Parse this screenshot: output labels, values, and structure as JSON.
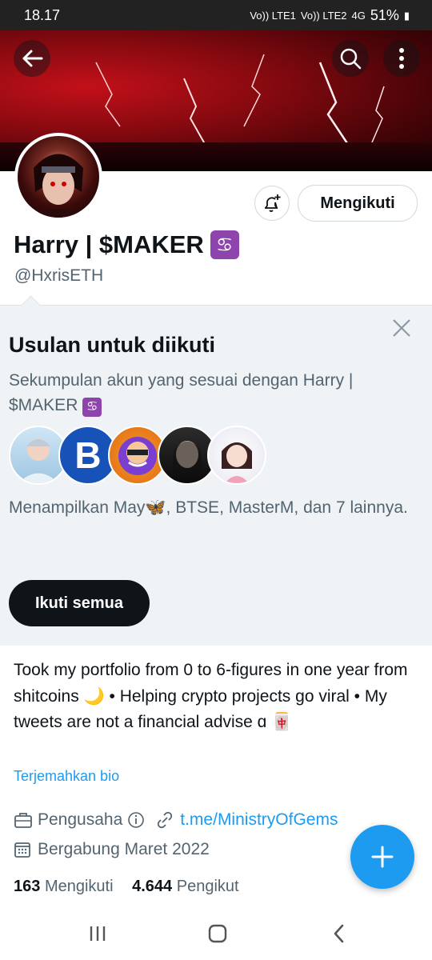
{
  "status_bar": {
    "time": "18.17",
    "sim1": "Vo)) LTE1",
    "sim2": "Vo)) LTE2",
    "network": "4G",
    "battery": "51%"
  },
  "profile": {
    "name": "Harry | $MAKER",
    "zodiac": "♋",
    "handle": "@HxrisETH",
    "follow_label": "Mengikuti"
  },
  "suggestions": {
    "title": "Usulan untuk diikuti",
    "description": "Sekumpulan akun yang sesuai dengan Harry | $MAKER",
    "shown_text": "Menampilkan May🦋, BTSE, MasterM, dan 7 lainnya.",
    "follow_all_label": "Ikuti semua",
    "avatars": [
      "may-avatar",
      "btse-avatar",
      "masterm-avatar",
      "izzy-avatar",
      "yalli-avatar"
    ],
    "btse_letter": "B"
  },
  "bio": {
    "text": "Took my portfolio from 0 to 6-figures in one year from shitcoins 🌙 • Helping crypto projects go viral • My tweets are not a financial advise ɑ 🀄",
    "translate_label": "Terjemahkan bio"
  },
  "meta": {
    "profession": "Pengusaha",
    "link": "t.me/MinistryOfGems",
    "joined": "Bergabung Maret 2022"
  },
  "counts": {
    "following_count": "163",
    "following_label": "Mengikuti",
    "followers_count": "4.644",
    "followers_label": "Pengikut"
  },
  "colors": {
    "accent": "#1d9bf0",
    "text": "#0f1419",
    "muted": "#536471",
    "banner_red": "#c3101a"
  }
}
